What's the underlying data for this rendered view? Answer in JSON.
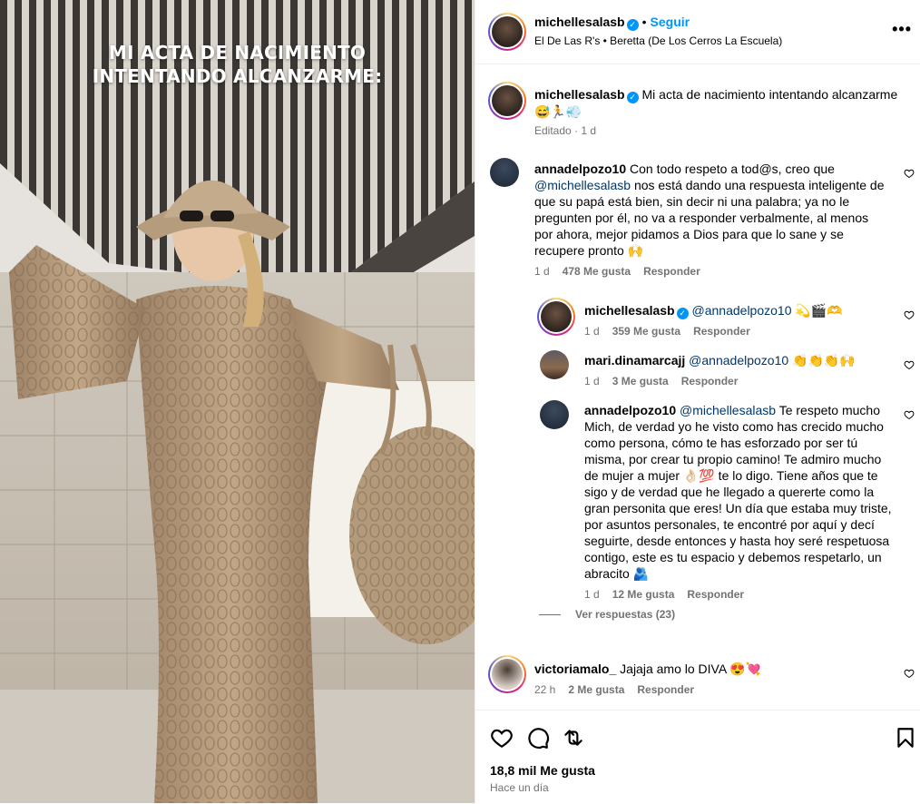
{
  "post": {
    "overlay_line1": "MI ACTA DE NACIMIENTO",
    "overlay_line2": "INTENTANDO ALCANZARME:"
  },
  "header": {
    "username": "michellesalasb",
    "follow_label": "Seguir",
    "subtitle": "El De Las R's • Beretta (De Los Cerros La Escuela)",
    "more_icon": "more-options-icon"
  },
  "caption": {
    "username": "michellesalasb",
    "text": "Mi acta de nacimiento intentando alcanzarme",
    "emojis": "😅🏃💨",
    "edited": "Editado",
    "time": "1 d"
  },
  "comments": [
    {
      "username": "annadelpozo10",
      "text_pre": "Con todo respeto a tod@s, creo que",
      "mention": "@michellesalasb",
      "text_post": "nos está dando una respuesta inteligente de que su papá está bien, sin decir ni una palabra; ya no le pregunten por él, no va a responder verbalmente, al menos por ahora, mejor pidamos a Dios para que lo sane y se recupere pronto 🙌",
      "time": "1 d",
      "likes": "478 Me gusta",
      "reply": "Responder"
    },
    {
      "username": "michellesalasb",
      "mention": "@annadelpozo10",
      "text": "💫🎬🫶",
      "time": "1 d",
      "likes": "359 Me gusta",
      "reply": "Responder"
    },
    {
      "username": "mari.dinamarcajj",
      "mention": "@annadelpozo10",
      "text": "👏👏👏🙌",
      "time": "1 d",
      "likes": "3 Me gusta",
      "reply": "Responder"
    },
    {
      "username": "annadelpozo10",
      "mention": "@michellesalasb",
      "text": "Te respeto mucho Mich, de verdad yo he visto como has crecido mucho como persona, cómo te has esforzado por ser tú misma, por crear tu propio camino! Te admiro mucho de mujer a mujer 👌🏻💯 te lo digo. Tiene años que te sigo y de verdad que he llegado a quererte como la gran personita que eres! Un día que estaba muy triste, por asuntos personales, te encontré por aquí y decí seguirte, desde entonces y hasta hoy seré respetuosa contigo, este es tu espacio y debemos respetarlo, un abracito 🫂",
      "time": "1 d",
      "likes": "12 Me gusta",
      "reply": "Responder"
    },
    {
      "username": "victoriamalo_",
      "text": "Jajaja amo lo DIVA 😍💘",
      "time": "22 h",
      "likes": "2 Me gusta",
      "reply": "Responder"
    }
  ],
  "view_replies": "Ver respuestas (23)",
  "footer": {
    "likes": "18,8 mil Me gusta",
    "time_ago": "Hace un día"
  },
  "colors": {
    "accent": "#0095f6",
    "mention": "#00376b",
    "muted": "#737373"
  }
}
